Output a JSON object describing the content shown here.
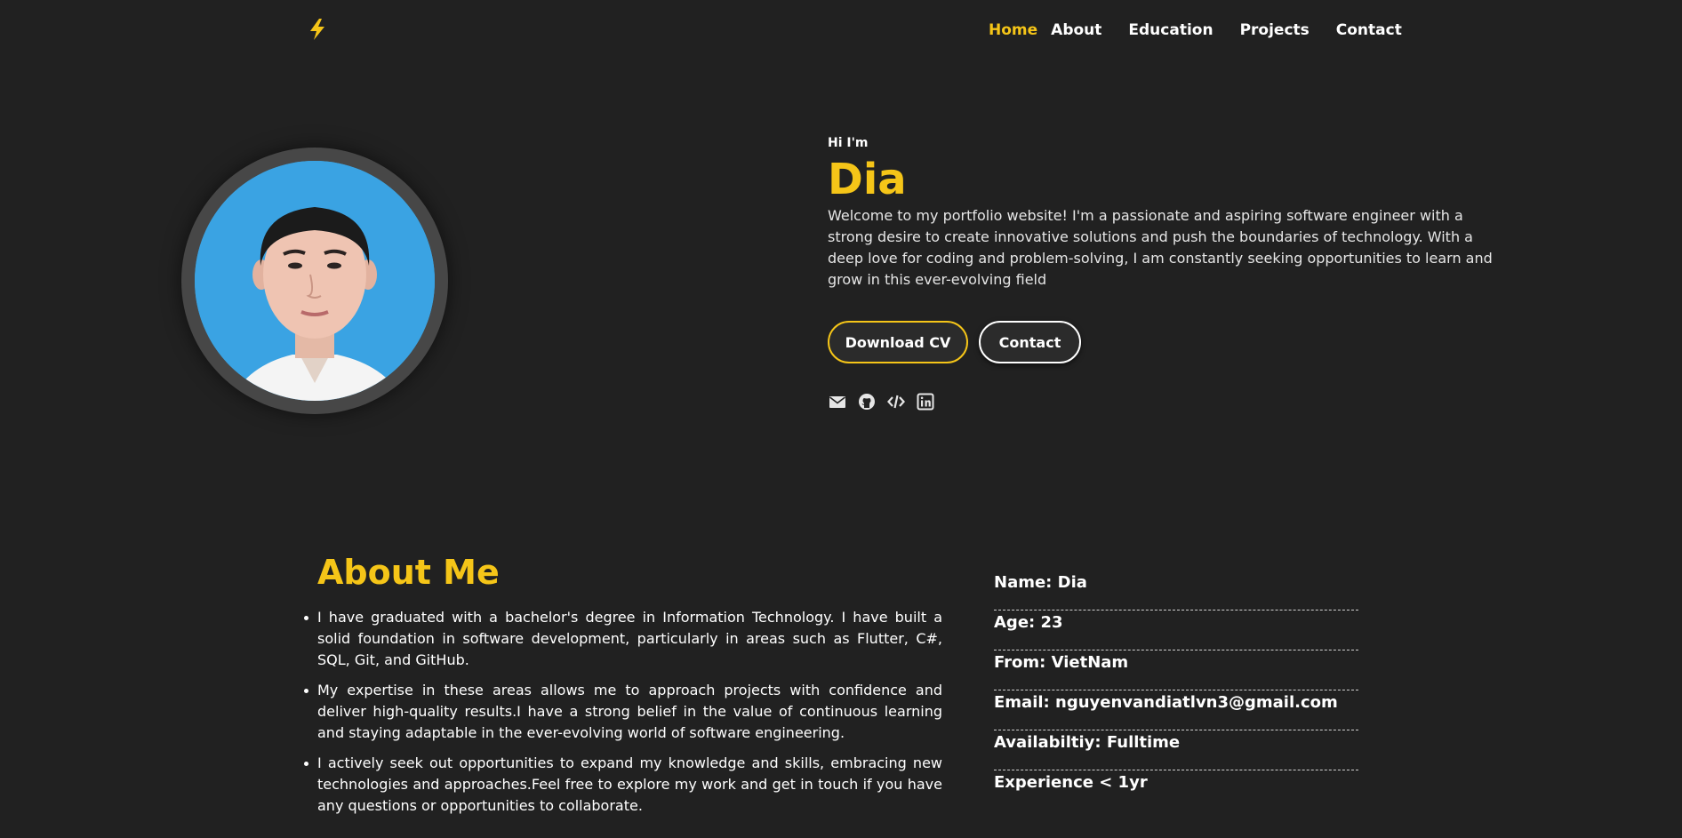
{
  "nav": {
    "logo_icon": "lightning-bolt-icon",
    "items": [
      {
        "label": "Home",
        "active": true
      },
      {
        "label": "About",
        "active": false
      },
      {
        "label": "Education",
        "active": false
      },
      {
        "label": "Projects",
        "active": false
      },
      {
        "label": "Contact",
        "active": false
      }
    ]
  },
  "hero": {
    "greeting": "Hi I'm",
    "name": "Dia",
    "intro": "Welcome to my portfolio website! I'm a passionate and aspiring software engineer with a strong desire to create innovative solutions and push the boundaries of technology. With a deep love for coding and problem-solving, I am constantly seeking opportunities to learn and grow in this ever-evolving field",
    "download_label": "Download CV",
    "contact_label": "Contact",
    "socials": [
      "email-icon",
      "github-icon",
      "code-icon",
      "linkedin-icon"
    ]
  },
  "about": {
    "title": "About Me",
    "points": [
      "I have graduated with a bachelor's degree in Information Technology. I have built a solid foundation in software development, particularly in areas such as Flutter, C#, SQL, Git, and GitHub.",
      "My expertise in these areas allows me to approach projects with confidence and deliver high-quality results.I have a strong belief in the value of continuous learning and staying adaptable in the ever-evolving world of software engineering.",
      "I actively seek out opportunities to expand my knowledge and skills, embracing new technologies and approaches.Feel free to explore my work and get in touch if you have any questions or opportunities to collaborate."
    ],
    "info": [
      "Name: Dia",
      "Age: 23",
      "From: VietNam",
      "Email: nguyenvandiatlvn3@gmail.com",
      "Availabiltiy: Fulltime",
      "Experience < 1yr"
    ]
  },
  "colors": {
    "background": "#212121",
    "accent": "#f5c518",
    "avatar_bg": "#3aa3e3"
  }
}
